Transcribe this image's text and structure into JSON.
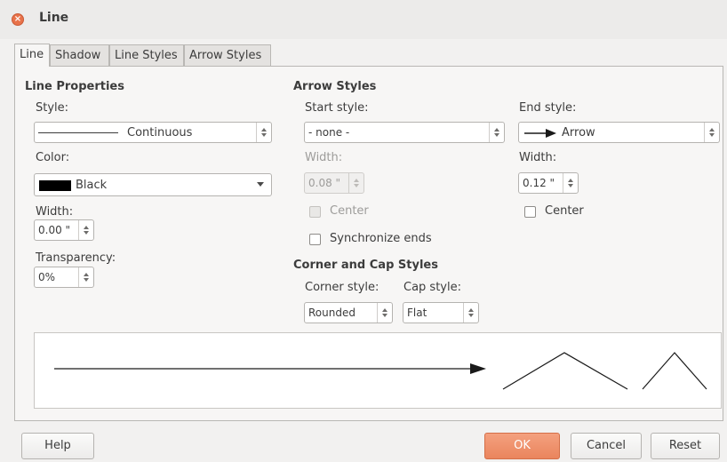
{
  "window": {
    "title": "Line"
  },
  "tabs": [
    "Line",
    "Shadow",
    "Line Styles",
    "Arrow Styles"
  ],
  "line_properties": {
    "heading": "Line Properties",
    "style_label": "Style:",
    "style_value": "Continuous",
    "color_label": "Color:",
    "color_value": "Black",
    "color_swatch": "#000000",
    "width_label": "Width:",
    "width_value": "0.00 \"",
    "transparency_label": "Transparency:",
    "transparency_value": "0%"
  },
  "arrow_styles": {
    "heading": "Arrow Styles",
    "start_label": "Start style:",
    "start_value": "- none -",
    "start_width_label": "Width:",
    "start_width_value": "0.08 \"",
    "start_center_label": "Center",
    "sync_label": "Synchronize ends",
    "end_label": "End style:",
    "end_value": "Arrow",
    "end_width_label": "Width:",
    "end_width_value": "0.12 \"",
    "end_center_label": "Center"
  },
  "corner_cap": {
    "heading": "Corner and Cap Styles",
    "corner_label": "Corner style:",
    "corner_value": "Rounded",
    "cap_label": "Cap style:",
    "cap_value": "Flat"
  },
  "buttons": {
    "help": "Help",
    "ok": "OK",
    "cancel": "Cancel",
    "reset": "Reset"
  },
  "colors": {
    "accent": "#ea855d"
  }
}
